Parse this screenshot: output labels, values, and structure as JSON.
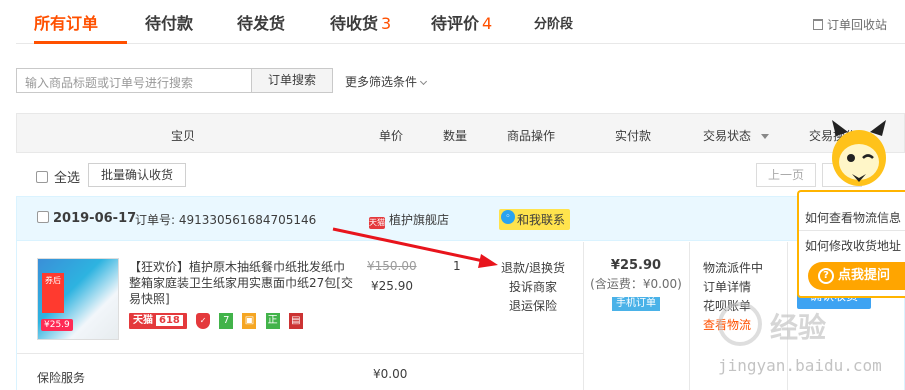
{
  "tabs": [
    {
      "label": "所有订单",
      "count": ""
    },
    {
      "label": "待付款",
      "count": ""
    },
    {
      "label": "待发货",
      "count": ""
    },
    {
      "label": "待收货",
      "count": "3"
    },
    {
      "label": "待评价",
      "count": "4"
    },
    {
      "label": "分阶段",
      "count": ""
    }
  ],
  "recycle_label": "订单回收站",
  "search": {
    "placeholder": "输入商品标题或订单号进行搜索",
    "button": "订单搜索",
    "more": "更多筛选条件"
  },
  "table_headers": [
    "宝贝",
    "单价",
    "数量",
    "商品操作",
    "实付款",
    "交易状态",
    "交易操作"
  ],
  "select_all": "全选",
  "batch_confirm": "批量确认收货",
  "prev_page": "上一页",
  "order": {
    "date": "2019-06-17",
    "order_no": "订单号: 491330561684705146",
    "shop": "植护旗舰店",
    "shop_badge": "天猫",
    "chat": "和我联系",
    "product_title": "【狂欢价】植护原木抽纸餐巾纸批发纸巾整箱家庭装卫生纸家用实惠面巾纸27包[交易快照]",
    "thumb_tag": "券后",
    "thumb_price": "¥25.9",
    "badge_tmall": "天猫",
    "badge_618": "618",
    "orig_price": "¥150.00",
    "unit_price": "¥25.90",
    "quantity": "1",
    "ops": [
      "退款/退换货",
      "投诉商家",
      "退运保险"
    ],
    "total": "¥25.90",
    "shipping": "(含运费：¥0.00)",
    "mobile_tag": "手机订单",
    "status": [
      "物流派件中",
      "订单详情",
      "花呗账单",
      "查看物流"
    ],
    "confirm_btn": "确认收货",
    "service_label": "保险服务",
    "service_price": "¥0.00"
  },
  "help": {
    "items": [
      "如何查看物流信息",
      "如何修改收货地址"
    ],
    "ask_button": "点我提问"
  },
  "watermark": {
    "brand": "经验",
    "url": "jingyan.baidu.com"
  },
  "colors": {
    "accent": "#ff5000",
    "blue": "#3ea3f2",
    "orange": "#ffa500"
  }
}
